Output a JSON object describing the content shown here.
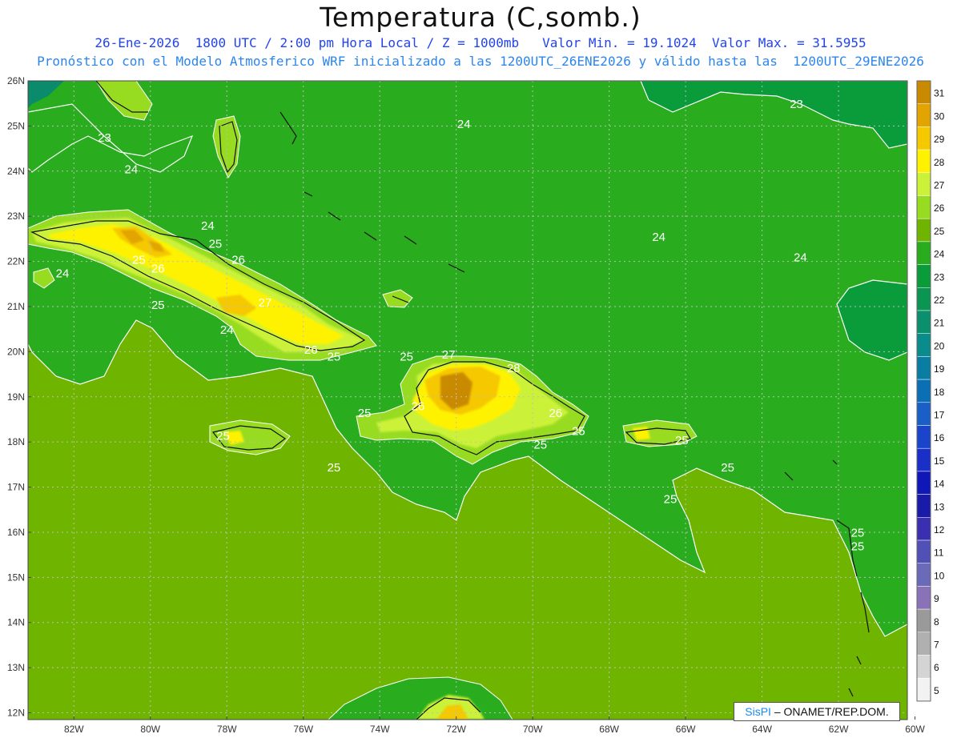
{
  "header": {
    "title": "Temperatura (C,somb.)",
    "line1": "26-Ene-2026  1800 UTC / 2:00 pm Hora Local / Z = 1000mb   Valor Min. = 19.1024  Valor Max. = 31.5955",
    "line2": "Pronóstico con el Modelo Atmosferico WRF inicializado a las 1200UTC_26ENE2026 y válido hasta las  1200UTC_29ENE2026"
  },
  "axes": {
    "lat_labels": [
      "26N",
      "25N",
      "24N",
      "23N",
      "22N",
      "21N",
      "20N",
      "19N",
      "18N",
      "17N",
      "16N",
      "15N",
      "14N",
      "13N",
      "12N"
    ],
    "lon_labels": [
      "82W",
      "80W",
      "78W",
      "76W",
      "74W",
      "72W",
      "70W",
      "68W",
      "66W",
      "64W",
      "62W",
      "60W"
    ]
  },
  "colorbar": {
    "labels": [
      "31",
      "30",
      "29",
      "28",
      "27",
      "26",
      "25",
      "24",
      "23",
      "22",
      "21",
      "20",
      "19",
      "18",
      "17",
      "16",
      "15",
      "14",
      "13",
      "12",
      "11",
      "10",
      "9",
      "8",
      "7",
      "6",
      "5"
    ],
    "colors": [
      "#c98a00",
      "#e1a400",
      "#f5c800",
      "#fff200",
      "#cbf238",
      "#98dc22",
      "#6fb500",
      "#29ad1e",
      "#0a9b3a",
      "#0b9552",
      "#0b8f6c",
      "#0a8b8c",
      "#0a7da3",
      "#0a6fb5",
      "#1a5fc7",
      "#1a44c9",
      "#1a2fc8",
      "#0f17b8",
      "#1a1aa8",
      "#3a2fb0",
      "#5050b5",
      "#6a6ab8",
      "#8a72b8",
      "#9a9a9a",
      "#b0b0b0",
      "#d4d4d4",
      "#f2f2f2"
    ]
  },
  "contour_labels": [
    {
      "text": "23",
      "lon": -81.2,
      "lat": 24.65
    },
    {
      "text": "24",
      "lon": -80.5,
      "lat": 23.95
    },
    {
      "text": "24",
      "lon": -78.5,
      "lat": 22.7
    },
    {
      "text": "25",
      "lon": -78.3,
      "lat": 22.3
    },
    {
      "text": "26",
      "lon": -77.7,
      "lat": 21.95
    },
    {
      "text": "25",
      "lon": -80.3,
      "lat": 21.95
    },
    {
      "text": "26",
      "lon": -79.8,
      "lat": 21.75
    },
    {
      "text": "24",
      "lon": -82.3,
      "lat": 21.65
    },
    {
      "text": "25",
      "lon": -79.8,
      "lat": 20.95
    },
    {
      "text": "27",
      "lon": -77.0,
      "lat": 21.0
    },
    {
      "text": "24",
      "lon": -78.0,
      "lat": 20.4
    },
    {
      "text": "26",
      "lon": -75.8,
      "lat": 19.95
    },
    {
      "text": "25",
      "lon": -75.2,
      "lat": 19.8
    },
    {
      "text": "25",
      "lon": -73.3,
      "lat": 19.8
    },
    {
      "text": "27",
      "lon": -72.2,
      "lat": 19.85
    },
    {
      "text": "28",
      "lon": -70.5,
      "lat": 19.55
    },
    {
      "text": "26",
      "lon": -73.0,
      "lat": 18.7
    },
    {
      "text": "25",
      "lon": -74.4,
      "lat": 18.55
    },
    {
      "text": "26",
      "lon": -69.4,
      "lat": 18.55
    },
    {
      "text": "25",
      "lon": -68.8,
      "lat": 18.15
    },
    {
      "text": "25",
      "lon": -69.8,
      "lat": 17.85
    },
    {
      "text": "25",
      "lon": -66.1,
      "lat": 17.95
    },
    {
      "text": "25",
      "lon": -75.2,
      "lat": 17.35
    },
    {
      "text": "25",
      "lon": -64.9,
      "lat": 17.35
    },
    {
      "text": "25",
      "lon": -66.4,
      "lat": 16.65
    },
    {
      "text": "25",
      "lon": -61.5,
      "lat": 15.9
    },
    {
      "text": "25",
      "lon": -61.5,
      "lat": 15.6
    },
    {
      "text": "25",
      "lon": -78.1,
      "lat": 18.05
    },
    {
      "text": "24",
      "lon": -71.8,
      "lat": 24.95
    },
    {
      "text": "24",
      "lon": -66.7,
      "lat": 22.45
    },
    {
      "text": "24",
      "lon": -63.0,
      "lat": 22.0
    },
    {
      "text": "23",
      "lon": -63.1,
      "lat": 25.4
    }
  ],
  "credit": {
    "brand": "SisPI",
    "text": " – ONAMET/REP.DOM."
  }
}
